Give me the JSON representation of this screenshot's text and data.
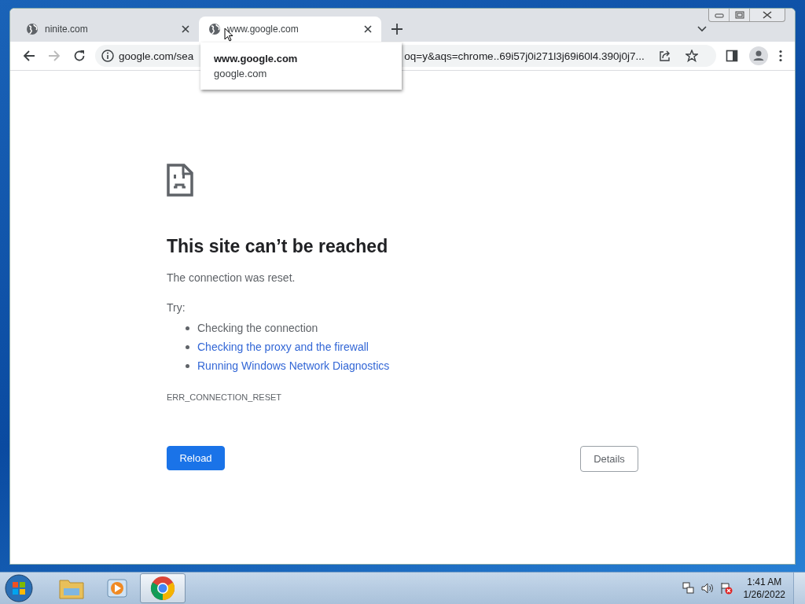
{
  "tabs": [
    {
      "title": "ninite.com",
      "selected": false
    },
    {
      "title": "www.google.com",
      "selected": true
    }
  ],
  "hover_card": {
    "title": "www.google.com",
    "host": "google.com"
  },
  "address_bar": {
    "text_start": "google.com/sea",
    "text_end": "oq=y&aqs=chrome..69i57j0i271l3j69i60l4.390j0j7..."
  },
  "error_page": {
    "heading": "This site can’t be reached",
    "message": "The connection was reset.",
    "try_label": "Try:",
    "suggestions": [
      {
        "text": "Checking the connection",
        "kind": "text"
      },
      {
        "text": "Checking the proxy and the firewall",
        "kind": "link"
      },
      {
        "text": "Running Windows Network Diagnostics",
        "kind": "link"
      }
    ],
    "error_code": "ERR_CONNECTION_RESET",
    "buttons": [
      {
        "label": "Reload",
        "kind": "primary"
      },
      {
        "label": "Details",
        "kind": "secondary"
      }
    ]
  },
  "taskbar": {
    "apps": [
      {
        "kind": "folder",
        "selected": false
      },
      {
        "kind": "media",
        "selected": false
      },
      {
        "kind": "browser",
        "selected": true
      }
    ],
    "time": "1:41 AM",
    "date": "1/26/2022"
  }
}
